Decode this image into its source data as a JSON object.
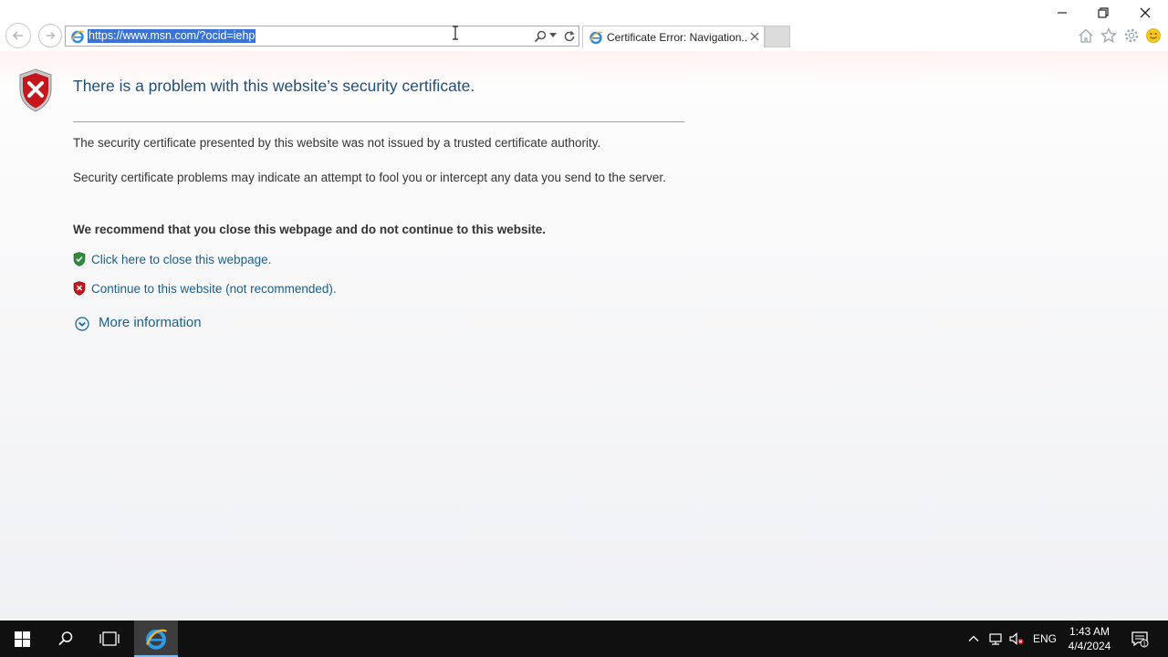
{
  "browser": {
    "address_url": "https://www.msn.com/?ocid=iehp",
    "tab_title": "Certificate Error: Navigation...",
    "colors": {
      "selection": "#3874d8",
      "link": "#1a5e8a",
      "title": "#1f4e79"
    }
  },
  "page": {
    "title": "There is a problem with this website’s security certificate.",
    "paragraph1": "The security certificate presented by this website was not issued by a trusted certificate authority.",
    "paragraph2": "Security certificate problems may indicate an attempt to fool you or intercept any data you send to the server.",
    "recommendation": "We recommend that you close this webpage and do not continue to this website.",
    "close_link": "Click here to close this webpage.",
    "continue_link": "Continue to this website (not recommended).",
    "more_info": "More information"
  },
  "taskbar": {
    "language": "ENG",
    "time": "1:43 AM",
    "date": "4/4/2024",
    "notification_count": "1"
  },
  "icons": {
    "toolbar": [
      "back-icon",
      "forward-icon",
      "ie-icon",
      "search-icon",
      "refresh-icon",
      "home-icon",
      "favorites-icon",
      "settings-icon",
      "feedback-smiley-icon"
    ],
    "page": [
      "error-shield-icon",
      "green-shield-icon",
      "red-shield-icon",
      "expand-circle-icon"
    ],
    "taskbar": [
      "windows-start-icon",
      "search-icon",
      "task-view-icon",
      "internet-explorer-icon",
      "chevron-up-icon",
      "network-icon",
      "volume-muted-icon",
      "notification-icon"
    ]
  }
}
